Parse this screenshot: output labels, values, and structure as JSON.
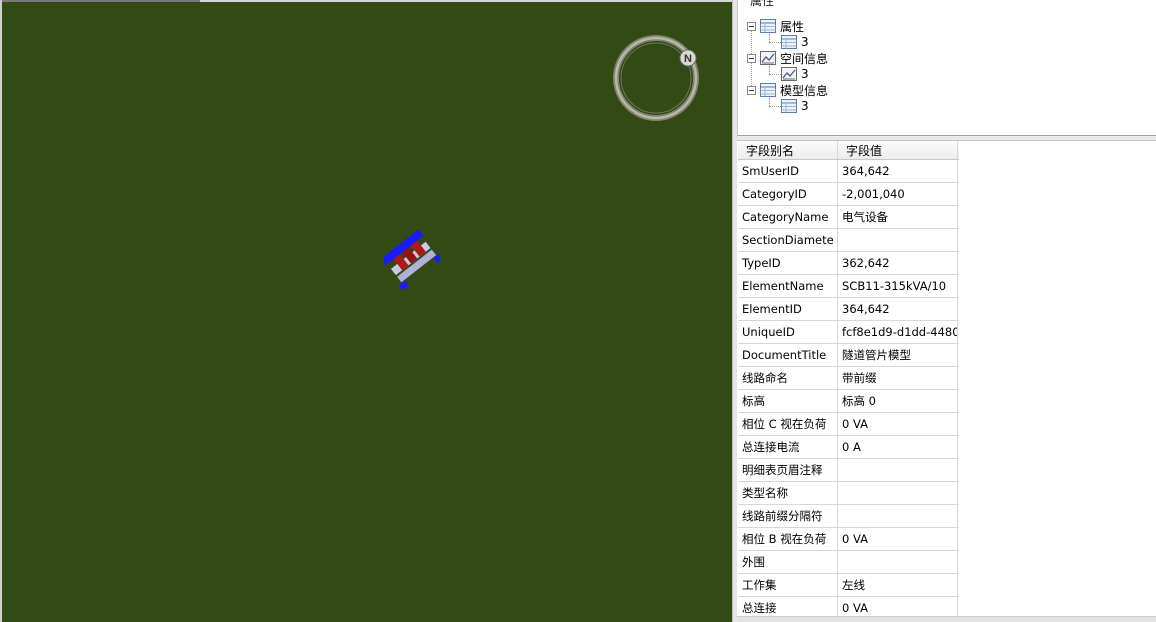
{
  "tree": {
    "header": "属性",
    "nodes": [
      {
        "label": "属性",
        "child": "3"
      },
      {
        "label": "空间信息",
        "child": "3"
      },
      {
        "label": "模型信息",
        "child": "3"
      }
    ]
  },
  "grid": {
    "columns": [
      "字段别名",
      "字段值"
    ],
    "rows": [
      {
        "name": "SmUserID",
        "value": "364,642"
      },
      {
        "name": "CategoryID",
        "value": "-2,001,040"
      },
      {
        "name": "CategoryName",
        "value": "电气设备"
      },
      {
        "name": "SectionDiamete",
        "value": ""
      },
      {
        "name": "TypeID",
        "value": "362,642"
      },
      {
        "name": "ElementName",
        "value": "SCB11-315kVA/10"
      },
      {
        "name": "ElementID",
        "value": "364,642"
      },
      {
        "name": "UniqueID",
        "value": "fcf8e1d9-d1dd-4480..."
      },
      {
        "name": "DocumentTitle",
        "value": "隧道管片模型"
      },
      {
        "name": "线路命名",
        "value": "带前缀"
      },
      {
        "name": "标高",
        "value": "标高 0"
      },
      {
        "name": "相位 C 视在负荷",
        "value": "0 VA"
      },
      {
        "name": "总连接电流",
        "value": "0 A"
      },
      {
        "name": "明细表页眉注释",
        "value": ""
      },
      {
        "name": "类型名称",
        "value": ""
      },
      {
        "name": "线路前缀分隔符",
        "value": ""
      },
      {
        "name": "相位 B 视在负荷",
        "value": "0 VA"
      },
      {
        "name": "外围",
        "value": ""
      },
      {
        "name": "工作集",
        "value": "左线"
      },
      {
        "name": "总连接",
        "value": "0 VA"
      }
    ]
  },
  "compass": {
    "label": "N"
  },
  "colors": {
    "viewport": "#324a14",
    "model_blue": "#1a1aff",
    "model_red": "#b01818"
  }
}
